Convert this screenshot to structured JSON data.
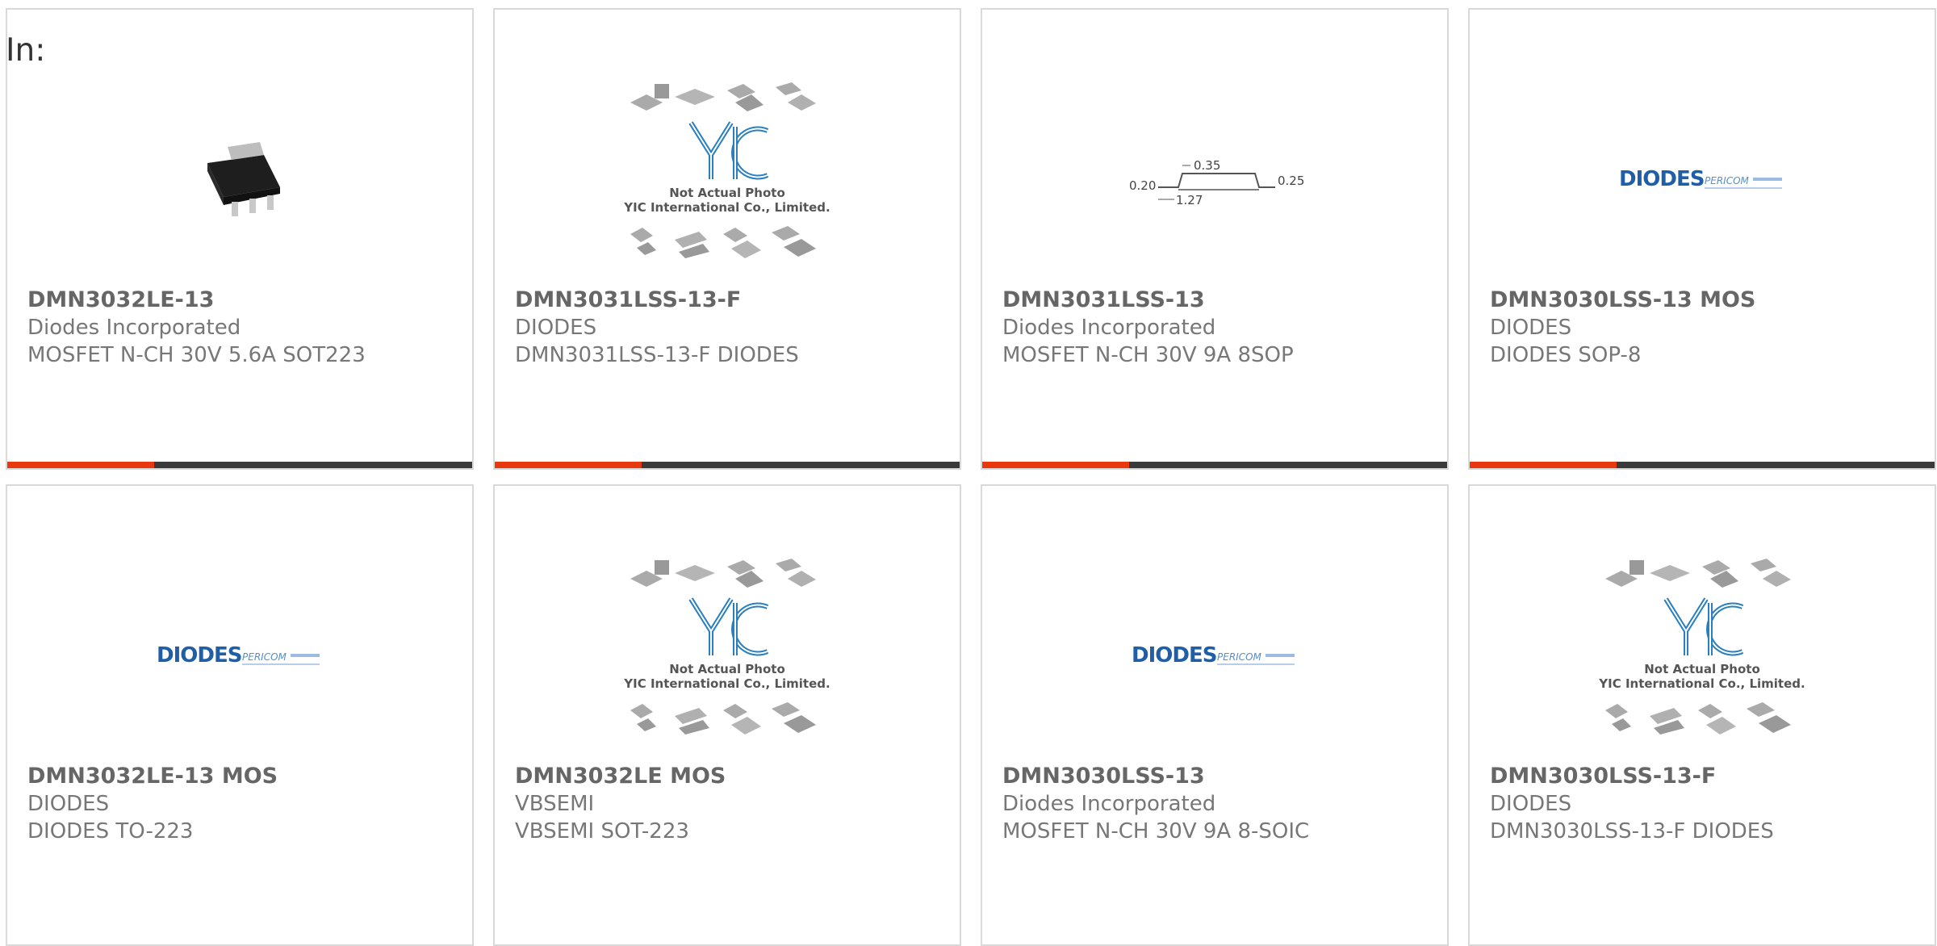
{
  "header": {
    "in_label": "In:"
  },
  "yic_caption": {
    "line1": "Not Actual Photo",
    "line2": "YIC International Co., Limited."
  },
  "package_drawing": {
    "d1": "0.35",
    "d2": "0.20",
    "d3": "0.25",
    "d4": "1.27"
  },
  "logo_text": {
    "diodes": "DIODES",
    "pericom": "PERICOM"
  },
  "colors": {
    "accent": "#e8380d",
    "bar": "#3a3a3a",
    "border": "#d9d9d9"
  },
  "products": [
    {
      "part": "DMN3032LE-13",
      "manufacturer": "Diodes Incorporated",
      "description": "MOSFET N-CH 30V 5.6A SOT223",
      "image": "sot223-photo"
    },
    {
      "part": "DMN3031LSS-13-F",
      "manufacturer": "DIODES",
      "description": "DMN3031LSS-13-F DIODES",
      "image": "yic-placeholder"
    },
    {
      "part": "DMN3031LSS-13",
      "manufacturer": "Diodes Incorporated",
      "description": "MOSFET N-CH 30V 9A 8SOP",
      "image": "package-drawing"
    },
    {
      "part": "DMN3030LSS-13 MOS",
      "manufacturer": "DIODES",
      "description": "DIODES SOP-8",
      "image": "diodes-logo"
    },
    {
      "part": "DMN3032LE-13 MOS",
      "manufacturer": "DIODES",
      "description": "DIODES TO-223",
      "image": "diodes-logo"
    },
    {
      "part": "DMN3032LE MOS",
      "manufacturer": "VBSEMI",
      "description": "VBSEMI SOT-223",
      "image": "yic-placeholder"
    },
    {
      "part": "DMN3030LSS-13",
      "manufacturer": "Diodes Incorporated",
      "description": "MOSFET N-CH 30V 9A 8-SOIC",
      "image": "diodes-logo"
    },
    {
      "part": "DMN3030LSS-13-F",
      "manufacturer": "DIODES",
      "description": "DMN3030LSS-13-F DIODES",
      "image": "yic-placeholder"
    }
  ]
}
